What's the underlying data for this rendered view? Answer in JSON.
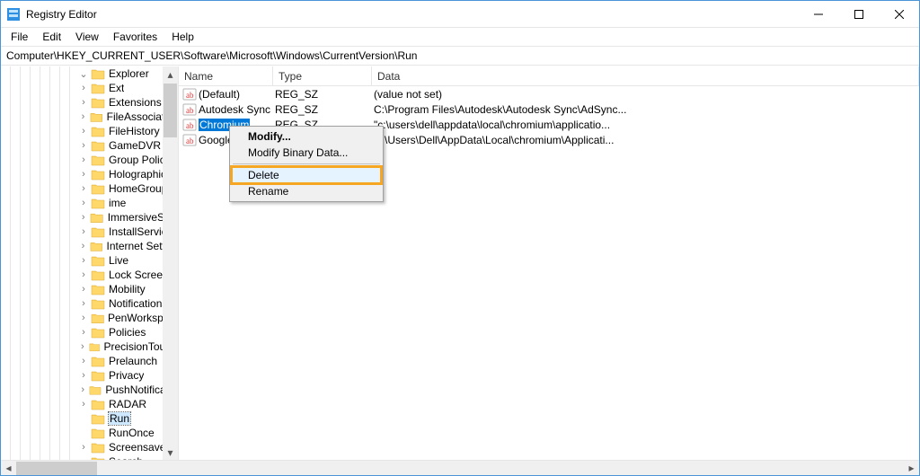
{
  "window": {
    "title": "Registry Editor"
  },
  "menu": {
    "file": "File",
    "edit": "Edit",
    "view": "View",
    "favorites": "Favorites",
    "help": "Help"
  },
  "address": {
    "path": "Computer\\HKEY_CURRENT_USER\\Software\\Microsoft\\Windows\\CurrentVersion\\Run"
  },
  "columns": {
    "name": "Name",
    "type": "Type",
    "data": "Data"
  },
  "tree": {
    "items": [
      {
        "label": "Explorer",
        "expanded": true
      },
      {
        "label": "Ext"
      },
      {
        "label": "Extensions"
      },
      {
        "label": "FileAssociations"
      },
      {
        "label": "FileHistory"
      },
      {
        "label": "GameDVR"
      },
      {
        "label": "Group Policy"
      },
      {
        "label": "Holographic"
      },
      {
        "label": "HomeGroup"
      },
      {
        "label": "ime"
      },
      {
        "label": "ImmersiveShell"
      },
      {
        "label": "InstallService"
      },
      {
        "label": "Internet Settings"
      },
      {
        "label": "Live"
      },
      {
        "label": "Lock Screen"
      },
      {
        "label": "Mobility"
      },
      {
        "label": "Notifications"
      },
      {
        "label": "PenWorkspace"
      },
      {
        "label": "Policies"
      },
      {
        "label": "PrecisionTouchPad"
      },
      {
        "label": "Prelaunch"
      },
      {
        "label": "Privacy"
      },
      {
        "label": "PushNotifications"
      },
      {
        "label": "RADAR"
      },
      {
        "label": "Run",
        "selected": true,
        "noexpander": true
      },
      {
        "label": "RunOnce",
        "noexpander": true
      },
      {
        "label": "Screensavers"
      },
      {
        "label": "Search",
        "expanded": true
      }
    ]
  },
  "values": [
    {
      "name": "(Default)",
      "type": "REG_SZ",
      "data": "(value not set)"
    },
    {
      "name": "Autodesk Sync",
      "type": "REG_SZ",
      "data": "C:\\Program Files\\Autodesk\\Autodesk Sync\\AdSync..."
    },
    {
      "name": "Chromium",
      "type": "REG_SZ",
      "data": "\"c:\\users\\dell\\appdata\\local\\chromium\\applicatio...",
      "selected": true
    },
    {
      "name": "GoogleChrome",
      "type": "REG_SZ",
      "data": "C:\\Users\\Dell\\AppData\\Local\\chromium\\Applicati..."
    }
  ],
  "contextmenu": {
    "items": [
      {
        "label": "Modify...",
        "bold": true
      },
      {
        "label": "Modify Binary Data..."
      },
      {
        "sep": true
      },
      {
        "label": "Delete",
        "highlighted": true
      },
      {
        "label": "Rename"
      }
    ]
  }
}
